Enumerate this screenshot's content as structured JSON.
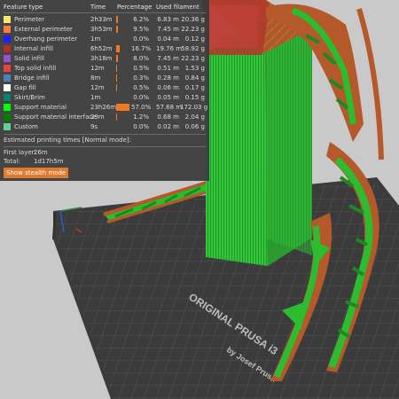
{
  "legend": {
    "headers": {
      "feature": "Feature type",
      "time": "Time",
      "percentage": "Percentage",
      "filament": "Used filament"
    },
    "rows": [
      {
        "name": "Perimeter",
        "time": "2h33m",
        "pct": "6.2%",
        "pct_value": 6.2,
        "length": "6.83 m",
        "weight": "20.36 g",
        "color": "#ffe66e"
      },
      {
        "name": "External perimeter",
        "time": "3h53m",
        "pct": "9.5%",
        "pct_value": 9.5,
        "length": "7.45 m",
        "weight": "22.23 g",
        "color": "#ff7d38"
      },
      {
        "name": "Overhang perimeter",
        "time": "1m",
        "pct": "0.0%",
        "pct_value": 0.0,
        "length": "0.04 m",
        "weight": "0.12 g",
        "color": "#1f1fff"
      },
      {
        "name": "Internal infill",
        "time": "6h52m",
        "pct": "16.7%",
        "pct_value": 16.7,
        "length": "19.76 m",
        "weight": "58.92 g",
        "color": "#b03029"
      },
      {
        "name": "Solid infill",
        "time": "3h18m",
        "pct": "8.0%",
        "pct_value": 8.0,
        "length": "7.45 m",
        "weight": "22.23 g",
        "color": "#9654cc"
      },
      {
        "name": "Top solid infill",
        "time": "12m",
        "pct": "0.5%",
        "pct_value": 0.5,
        "length": "0.51 m",
        "weight": "1.53 g",
        "color": "#f04040"
      },
      {
        "name": "Bridge infill",
        "time": "8m",
        "pct": "0.3%",
        "pct_value": 0.3,
        "length": "0.28 m",
        "weight": "0.84 g",
        "color": "#4d80ba"
      },
      {
        "name": "Gap fill",
        "time": "12m",
        "pct": "0.5%",
        "pct_value": 0.5,
        "length": "0.06 m",
        "weight": "0.17 g",
        "color": "#ffffff"
      },
      {
        "name": "Skirt/Brim",
        "time": "1m",
        "pct": "0.0%",
        "pct_value": 0.0,
        "length": "0.05 m",
        "weight": "0.15 g",
        "color": "#00876e"
      },
      {
        "name": "Support material",
        "time": "23h26m",
        "pct": "57.0%",
        "pct_value": 57.0,
        "length": "57.68 m",
        "weight": "172.03 g",
        "color": "#00ff00"
      },
      {
        "name": "Support material interface",
        "time": "29m",
        "pct": "1.2%",
        "pct_value": 1.2,
        "length": "0.68 m",
        "weight": "2.04 g",
        "color": "#008000"
      },
      {
        "name": "Custom",
        "time": "9s",
        "pct": "0.0%",
        "pct_value": 0.0,
        "length": "0.02 m",
        "weight": "0.06 g",
        "color": "#5ed194"
      }
    ],
    "estimated_title": "Estimated printing times [Normal mode]:",
    "first_layer_label": "First layer:",
    "first_layer_value": "26m",
    "total_label": "Total:",
    "total_value": "1d17h5m",
    "stealth_button": "Show stealth mode"
  },
  "bed": {
    "brand_line1": "ORIGINAL PRUSA i3",
    "brand_line2": "by Josef Prusa"
  },
  "colors": {
    "panel_bg": "#3a3a3a",
    "accent": "#f07a22",
    "support": "#22c422",
    "perimeter": "#b5582a"
  }
}
